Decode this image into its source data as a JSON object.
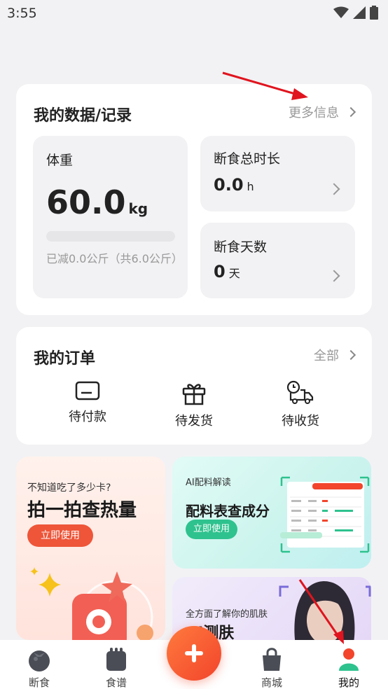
{
  "status_bar": {
    "time": "3:55"
  },
  "data_section": {
    "title": "我的数据/记录",
    "more_label": "更多信息",
    "weight": {
      "label": "体重",
      "value": "60.0",
      "unit": "kg",
      "progress_fraction": 0.0,
      "reduced_text": "已减0.0公斤（共6.0公斤）"
    },
    "fasting_total": {
      "label": "断食总时长",
      "value": "0.0",
      "unit": "h"
    },
    "fasting_days": {
      "label": "断食天数",
      "value": "0",
      "unit": "天"
    }
  },
  "orders": {
    "title": "我的订单",
    "all_label": "全部",
    "items": [
      {
        "label": "待付款",
        "icon": "card-icon"
      },
      {
        "label": "待发货",
        "icon": "gift-icon"
      },
      {
        "label": "待收货",
        "icon": "delivery-truck-icon"
      }
    ]
  },
  "promos": {
    "calorie": {
      "subtitle": "不知道吃了多少卡?",
      "title": "拍一拍查热量",
      "button": "立即使用"
    },
    "ingredient": {
      "subtitle": "AI配料解读",
      "title": "配料表查成分",
      "button": "立即使用"
    },
    "skin": {
      "subtitle": "全方面了解你的肌肤",
      "title": "AI测肤"
    }
  },
  "tabs": [
    {
      "label": "断食",
      "icon": "tomato-icon"
    },
    {
      "label": "食谱",
      "icon": "recipe-icon"
    },
    {
      "label": "商城",
      "icon": "shopping-bag-icon"
    },
    {
      "label": "我的",
      "icon": "profile-icon",
      "active": true
    }
  ],
  "colors": {
    "accent": "#f2452c",
    "green": "#2ec28e",
    "annotation_arrow": "#e0141e"
  }
}
